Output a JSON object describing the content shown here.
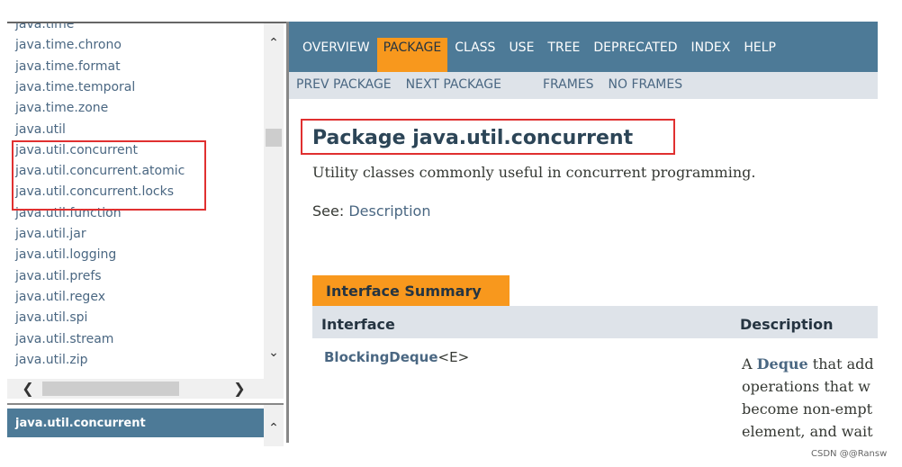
{
  "package_list": {
    "items": [
      "java.time",
      "java.time.chrono",
      "java.time.format",
      "java.time.temporal",
      "java.time.zone",
      "java.util",
      "java.util.concurrent",
      "java.util.concurrent.atomic",
      "java.util.concurrent.locks",
      "java.util.function",
      "java.util.jar",
      "java.util.logging",
      "java.util.prefs",
      "java.util.regex",
      "java.util.spi",
      "java.util.stream",
      "java.util.zip"
    ],
    "highlighted": [
      "java.util.concurrent",
      "java.util.concurrent.atomic",
      "java.util.concurrent.locks"
    ]
  },
  "selected_package": "java.util.concurrent",
  "nav": {
    "items": [
      "OVERVIEW",
      "PACKAGE",
      "CLASS",
      "USE",
      "TREE",
      "DEPRECATED",
      "INDEX",
      "HELP"
    ],
    "active": "PACKAGE"
  },
  "subnav": {
    "prev": "PREV PACKAGE",
    "next": "NEXT PACKAGE",
    "frames": "FRAMES",
    "no_frames": "NO FRAMES"
  },
  "main": {
    "title": "Package java.util.concurrent",
    "description": "Utility classes commonly useful in concurrent programming.",
    "see_label": "See:",
    "see_link": "Description",
    "summary_caption": "Interface Summary",
    "columns": [
      "Interface",
      "Description"
    ],
    "rows": [
      {
        "name": "BlockingDeque",
        "type_param": "<E>",
        "desc_link": "Deque",
        "desc_lines": [
          "A ",
          "operations that w",
          "become non-empt",
          "element, and wait"
        ],
        "desc_rest": " that add"
      }
    ]
  },
  "colors": {
    "nav_bg": "#4d7a97",
    "active_tab": "#f8981d",
    "subnav_bg": "#dee3e9",
    "highlight_box": "#e03030"
  },
  "watermark": "CSDN @@Ransw"
}
